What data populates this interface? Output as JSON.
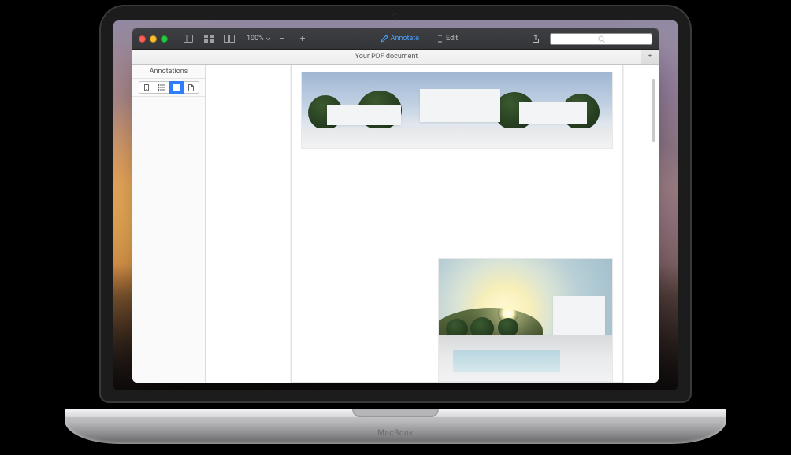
{
  "toolbar": {
    "zoom_label": "100%",
    "annotate_label": "Annotate",
    "edit_label": "Edit",
    "icons": {
      "sidebar": "sidebar-toggle-icon",
      "thumbnails": "thumbnails-grid-icon",
      "view_mode": "two-page-icon",
      "zoom_out": "minus-icon",
      "zoom_in": "plus-icon",
      "annotate": "pencil-icon",
      "edit": "text-cursor-icon",
      "share": "share-icon",
      "search": "search-icon"
    }
  },
  "tabbar": {
    "active_tab": "Your PDF document",
    "add_tab_glyph": "+"
  },
  "sidebar": {
    "title": "Annotations",
    "tabs": [
      {
        "name": "bookmarks",
        "icon": "bookmark-icon",
        "active": false
      },
      {
        "name": "outline",
        "icon": "list-outline-icon",
        "active": false
      },
      {
        "name": "annotations",
        "icon": "annotations-icon",
        "active": true
      },
      {
        "name": "page",
        "icon": "page-icon",
        "active": false
      }
    ]
  },
  "colors": {
    "accent": "#4aa3ff",
    "selection": "#2f7dff"
  },
  "device": {
    "label": "MacBook"
  }
}
